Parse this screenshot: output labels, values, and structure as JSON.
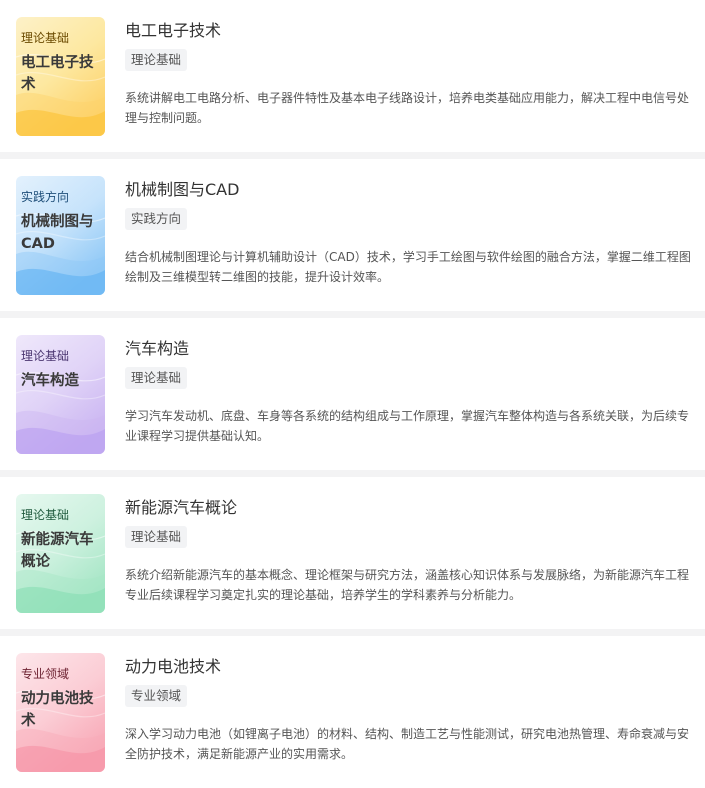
{
  "courses": [
    {
      "cover_tag": "理论基础",
      "cover_title": "电工电子技术",
      "cover_theme": "amber",
      "cover_colors": [
        "#fdf1c8",
        "#fde8a0",
        "#fdd26a",
        "#fbbf2c"
      ],
      "cover_tag_color": "#6b4a00",
      "title": "电工电子技术",
      "badge": "理论基础",
      "description": "系统讲解电工电路分析、电子器件特性及基本电子线路设计，培养电类基础应用能力，解决工程中电信号处理与控制问题。"
    },
    {
      "cover_tag": "实践方向",
      "cover_title": "机械制图与CAD",
      "cover_theme": "blue",
      "cover_colors": [
        "#e3f1fd",
        "#c6e3fb",
        "#8ec8f6",
        "#5aaef2"
      ],
      "cover_tag_color": "#1f4f7a",
      "title": "机械制图与CAD",
      "badge": "实践方向",
      "description": "结合机械制图理论与计算机辅助设计（CAD）技术，学习手工绘图与软件绘图的融合方法，掌握二维工程图绘制及三维模型转二维图的技能，提升设计效率。"
    },
    {
      "cover_tag": "理论基础",
      "cover_title": "汽车构造",
      "cover_theme": "purple",
      "cover_colors": [
        "#efe8fb",
        "#e0d3f7",
        "#cbb6f2",
        "#b69af0"
      ],
      "cover_tag_color": "#4a3570",
      "title": "汽车构造",
      "badge": "理论基础",
      "description": "学习汽车发动机、底盘、车身等各系统的结构组成与工作原理，掌握汽车整体构造与各系统关联，为后续专业课程学习提供基础认知。"
    },
    {
      "cover_tag": "理论基础",
      "cover_title": "新能源汽车概论",
      "cover_theme": "green",
      "cover_colors": [
        "#e6f8ef",
        "#cdf1df",
        "#a6e6c6",
        "#84dcb0"
      ],
      "cover_tag_color": "#1f5a3d",
      "title": "新能源汽车概论",
      "badge": "理论基础",
      "description": "系统介绍新能源汽车的基本概念、理论框架与研究方法，涵盖核心知识体系与发展脉络，为新能源汽车工程专业后续课程学习奠定扎实的理论基础，培养学生的学科素养与分析能力。"
    },
    {
      "cover_tag": "专业领域",
      "cover_title": "动力电池技术",
      "cover_theme": "pink",
      "cover_colors": [
        "#fde6ea",
        "#fbcdd5",
        "#f8aab8",
        "#f58ea2"
      ],
      "cover_tag_color": "#6e2433",
      "title": "动力电池技术",
      "badge": "专业领域",
      "description": "深入学习动力电池（如锂离子电池）的材料、结构、制造工艺与性能测试，研究电池热管理、寿命衰减与安全防护技术，满足新能源产业的实用需求。"
    }
  ]
}
